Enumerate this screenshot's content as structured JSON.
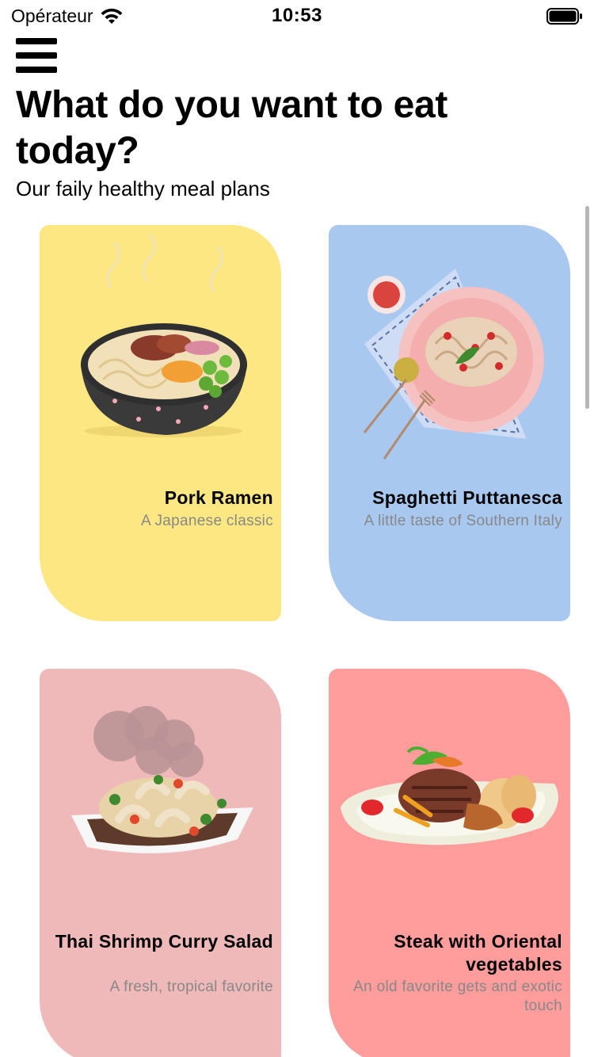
{
  "status_bar": {
    "carrier": "Opérateur",
    "time": "10:53"
  },
  "header": {
    "title": "What do you want to eat today?",
    "subtitle": "Our faily healthy meal plans"
  },
  "meals": [
    {
      "name": "Pork Ramen",
      "description": "A Japanese classic",
      "color": "#FDE783",
      "icon": "ramen-bowl-icon"
    },
    {
      "name": "Spaghetti Puttanesca",
      "description": "A little taste of Southern Italy",
      "color": "#A8C8F0",
      "icon": "spaghetti-plate-icon"
    },
    {
      "name": "Thai Shrimp Curry Salad",
      "description": "A fresh, tropical favorite",
      "color": "#F0B9B9",
      "icon": "shrimp-curry-icon"
    },
    {
      "name": "Steak with Oriental vegetables",
      "description": "An old favorite gets and exotic touch",
      "color": "#FF9C9C",
      "icon": "steak-plate-icon"
    }
  ]
}
